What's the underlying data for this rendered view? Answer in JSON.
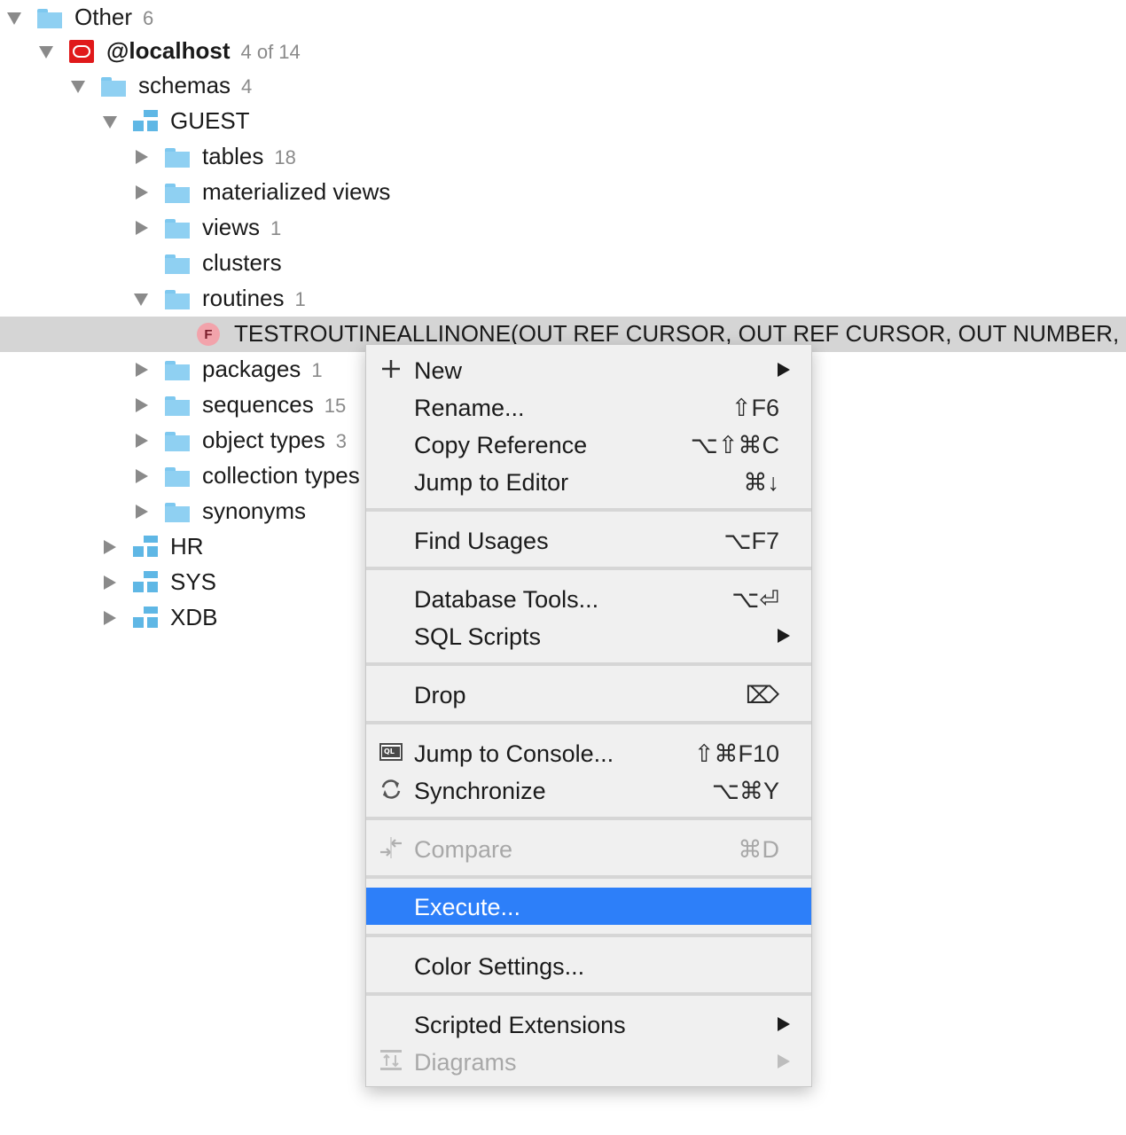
{
  "tree": {
    "other": {
      "label": "Other",
      "count": "6"
    },
    "localhost": {
      "label": "@localhost",
      "count": "4 of 14"
    },
    "schemas": {
      "label": "schemas",
      "count": "4"
    },
    "guest": {
      "label": "GUEST"
    },
    "tables": {
      "label": "tables",
      "count": "18"
    },
    "materialized_views": {
      "label": "materialized views"
    },
    "views": {
      "label": "views",
      "count": "1"
    },
    "clusters": {
      "label": "clusters"
    },
    "routines": {
      "label": "routines",
      "count": "1"
    },
    "routine_item": {
      "badge": "F",
      "label": "TESTROUTINEALLINONE(OUT REF CURSOR, OUT REF CURSOR, OUT NUMBER, OUT NUMBER)"
    },
    "packages": {
      "label": "packages",
      "count": "1"
    },
    "sequences": {
      "label": "sequences",
      "count": "15"
    },
    "object_types": {
      "label": "object types",
      "count": "3"
    },
    "collection_types": {
      "label": "collection types"
    },
    "synonyms": {
      "label": "synonyms"
    },
    "hr": {
      "label": "HR"
    },
    "sys": {
      "label": "SYS"
    },
    "xdb": {
      "label": "XDB"
    }
  },
  "menu": {
    "new": {
      "icon": "plus-icon",
      "label": "New"
    },
    "rename": {
      "label": "Rename...",
      "shortcut": "⇧F6"
    },
    "copy_reference": {
      "label": "Copy Reference",
      "shortcut": "⌥⇧⌘C"
    },
    "jump_to_editor": {
      "label": "Jump to Editor",
      "shortcut": "⌘↓"
    },
    "find_usages": {
      "label": "Find Usages",
      "shortcut": "⌥F7"
    },
    "database_tools": {
      "label": "Database Tools...",
      "shortcut": "⌥⏎"
    },
    "sql_scripts": {
      "label": "SQL Scripts"
    },
    "drop": {
      "label": "Drop",
      "shortcut": "⌦"
    },
    "jump_to_console": {
      "icon": "console-icon",
      "icon_text": "QL",
      "label": "Jump to Console...",
      "shortcut": "⇧⌘F10"
    },
    "synchronize": {
      "icon": "sync-icon",
      "label": "Synchronize",
      "shortcut": "⌥⌘Y"
    },
    "compare": {
      "icon": "compare-icon",
      "label": "Compare",
      "shortcut": "⌘D"
    },
    "execute": {
      "label": "Execute..."
    },
    "color_settings": {
      "label": "Color Settings..."
    },
    "scripted_extensions": {
      "label": "Scripted Extensions"
    },
    "diagrams": {
      "icon": "diagram-icon",
      "label": "Diagrams"
    }
  },
  "colors": {
    "selection": "#2d7ff9",
    "folder": "#8fd0f2",
    "oracle": "#e0191a"
  }
}
